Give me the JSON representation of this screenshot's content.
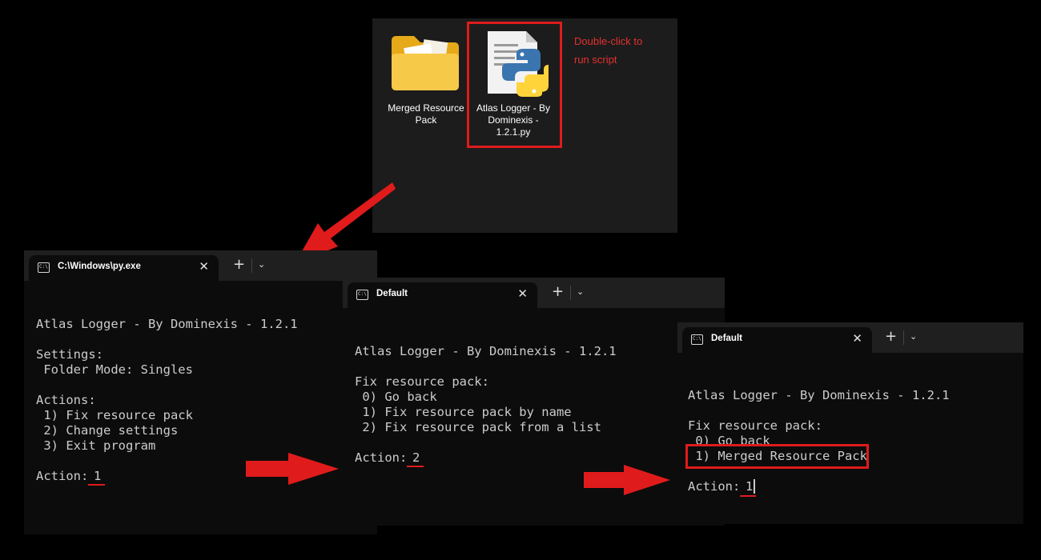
{
  "explorer": {
    "folder_label_line1": "Merged Resource",
    "folder_label_line2": "Pack",
    "script_label_line1": "Atlas Logger - By",
    "script_label_line2": "Dominexis -",
    "script_label_line3": "1.2.1.py",
    "annotation_line1": "Double-click to",
    "annotation_line2": "run script"
  },
  "terminal1": {
    "tab_title": "C:\\Windows\\py.exe",
    "header": "Atlas Logger - By Dominexis - 1.2.1",
    "settings_heading": "Settings:",
    "settings_folder_mode": " Folder Mode: Singles",
    "actions_heading": "Actions:",
    "actions": [
      " 1) Fix resource pack",
      " 2) Change settings",
      " 3) Exit program"
    ],
    "prompt": "Action: ",
    "input": "1"
  },
  "terminal2": {
    "tab_title": "Default",
    "header": "Atlas Logger - By Dominexis - 1.2.1",
    "menu_heading": "Fix resource pack:",
    "options": [
      " 0) Go back",
      " 1) Fix resource pack by name",
      " 2) Fix resource pack from a list"
    ],
    "prompt": "Action: ",
    "input": "2"
  },
  "terminal3": {
    "tab_title": "Default",
    "header": "Atlas Logger - By Dominexis - 1.2.1",
    "menu_heading": "Fix resource pack:",
    "options": [
      " 0) Go back",
      " 1) Merged Resource Pack"
    ],
    "prompt": "Action: ",
    "input": "1"
  },
  "colors": {
    "annotation_red": "#e01b1b",
    "terminal_bg": "#0c0c0c",
    "terminal_text": "#cccccc"
  },
  "icons": [
    "folder-icon",
    "python-file-icon",
    "terminal-icon",
    "close-icon",
    "plus-icon",
    "chevron-down-icon",
    "red-arrow-icon"
  ]
}
